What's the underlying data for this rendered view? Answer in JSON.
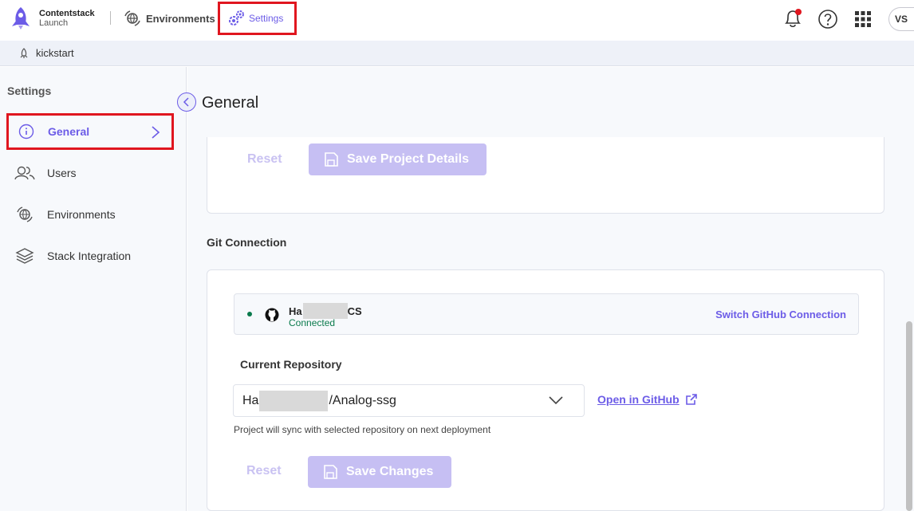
{
  "topbar": {
    "brand_name": "Contentstack",
    "brand_sub": "Launch",
    "nav_environments": "Environments",
    "nav_settings": "Settings",
    "avatar_initials": "VS"
  },
  "project": {
    "name": "kickstart"
  },
  "sidebar": {
    "title": "Settings",
    "items": [
      {
        "label": "General",
        "icon": "info-icon"
      },
      {
        "label": "Users",
        "icon": "users-icon"
      },
      {
        "label": "Environments",
        "icon": "environments-icon"
      },
      {
        "label": "Stack Integration",
        "icon": "layers-icon"
      }
    ]
  },
  "main": {
    "title": "General",
    "project_details": {
      "reset_label": "Reset",
      "save_label": "Save Project Details"
    },
    "git": {
      "section_title": "Git Connection",
      "account_prefix": "Ha",
      "account_suffix": "CS",
      "status": "Connected",
      "switch_label": "Switch GitHub Connection",
      "repo_label": "Current Repository",
      "repo_prefix": "Ha",
      "repo_suffix": "/Analog-ssg",
      "open_github": "Open in GitHub",
      "hint": "Project will sync with selected repository on next deployment",
      "reset_label": "Reset",
      "save_label": "Save Changes"
    }
  },
  "colors": {
    "accent": "#6c5ce7",
    "highlight_border": "#e0161f",
    "connected": "#0a7a4c",
    "disabled_button": "#c6bff3"
  }
}
